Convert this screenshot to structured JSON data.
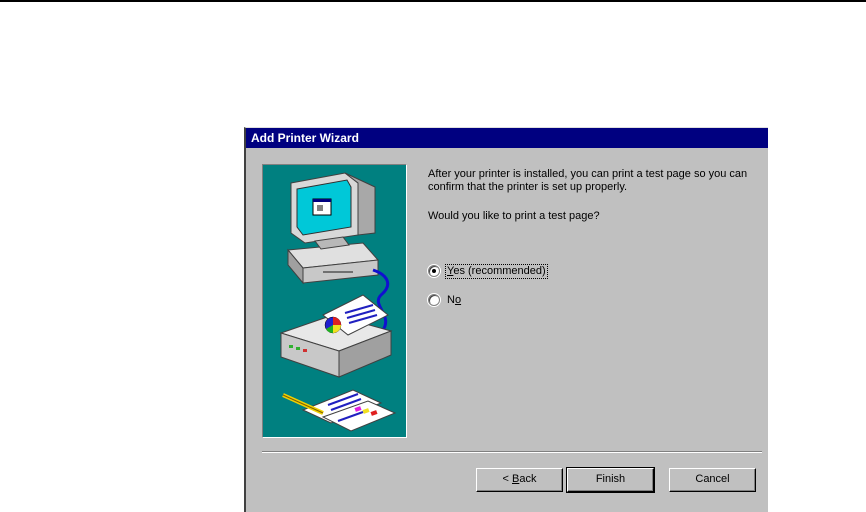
{
  "wizard": {
    "title": "Add Printer Wizard",
    "message": "After your printer is installed, you can print a test page so you can confirm that the printer is set up properly.",
    "question": "Would you like to print a test page?",
    "options": [
      {
        "label_before": "",
        "mnemonic": "Y",
        "label_after": "es (recommended)",
        "selected": true
      },
      {
        "label_before": "N",
        "mnemonic": "o",
        "label_after": "",
        "selected": false
      }
    ],
    "buttons": {
      "back": {
        "prefix": "< ",
        "mnemonic": "B",
        "rest": "ack"
      },
      "finish": "Finish",
      "cancel": "Cancel"
    }
  },
  "colors": {
    "title_bar": "#000080",
    "dialog_face": "#c0c0c0",
    "illustration_bg": "#008080"
  },
  "icons": [
    "computer-icon",
    "printer-icon",
    "printed-pages-icon",
    "pencil-icon"
  ]
}
